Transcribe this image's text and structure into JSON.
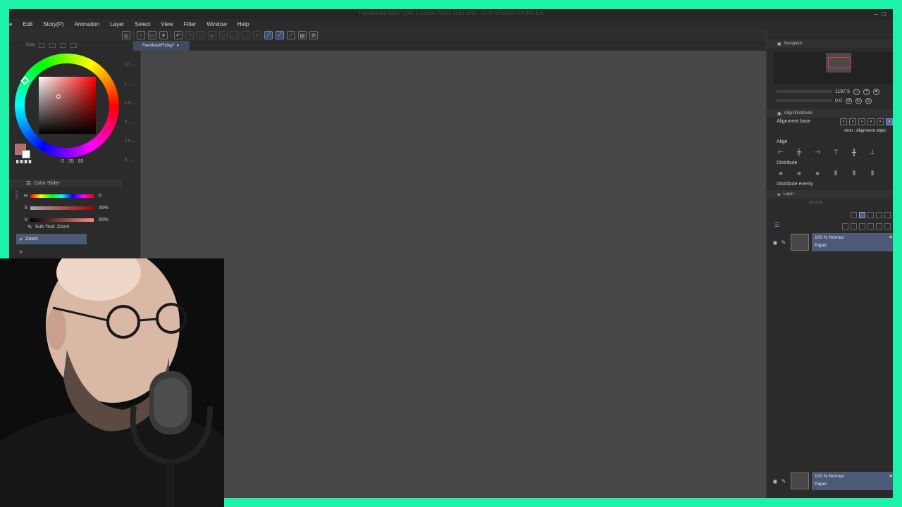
{
  "title_bar": {
    "title": "FeedbackFriday* (190 x 150px 72dpi 1197.5%) - CLIP STUDIO PAINT EX"
  },
  "menu": {
    "items": [
      "e",
      "Edit",
      "Story(P)",
      "Animation",
      "Layer",
      "Select",
      "View",
      "Filter",
      "Window",
      "Help"
    ]
  },
  "document_tab": {
    "label": "FeedbackFriday*"
  },
  "color_wheel": {
    "tab_label": "Colo",
    "values": [
      "0",
      "35",
      "65"
    ],
    "main_color": "#b86a6a"
  },
  "color_slider": {
    "header": "Color Slider",
    "mode_label": "HSV",
    "rows": [
      {
        "label": "H",
        "value": "0"
      },
      {
        "label": "S",
        "value": "35%"
      },
      {
        "label": "V",
        "value": "65%"
      }
    ]
  },
  "ruler": {
    "ticks": [
      "0.7",
      "1",
      "1.5",
      "2",
      "2.5",
      "3"
    ]
  },
  "sub_tool": {
    "header": "Sub Tool: Zoom",
    "selected_item": "Zoom"
  },
  "navigator": {
    "header": "Navigator",
    "zoom_value": "1197.5",
    "rotation_value": "0.0"
  },
  "align_distribute": {
    "header": "Align/Distribute",
    "alignment_base_label": "Alignment base",
    "auto_label": "Auto : Alignment objec",
    "align_label": "Align",
    "distribute_label": "Distribute",
    "distribute_evenly_label": "Distribute evenly"
  },
  "layer_panel": {
    "header": "Layer",
    "blend_mode": "Normal",
    "layers": [
      {
        "opacity_mode": "100 % Normal",
        "name": "Paper"
      },
      {
        "opacity_mode": "100 % Normal",
        "name": "Paper"
      }
    ]
  },
  "colors": {
    "frame_border": "#1ef1a8",
    "canvas_bg": "#474747",
    "selection_blue": "#4b5a76"
  }
}
